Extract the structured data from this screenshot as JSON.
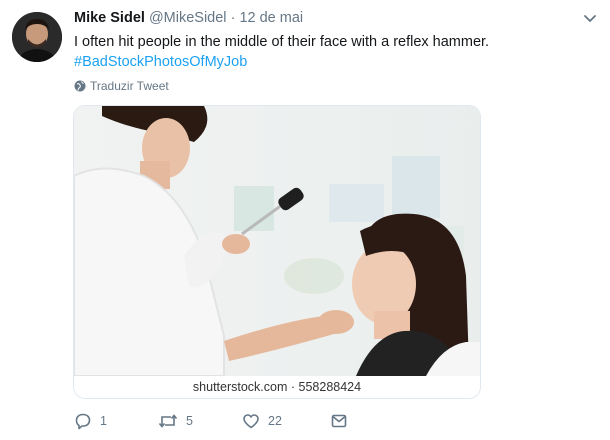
{
  "tweet": {
    "author_name": "Mike Sidel",
    "author_handle": "@MikeSidel",
    "separator": "·",
    "date": "12 de mai",
    "text": "I often hit people in the middle of their face with a reflex hammer.",
    "hashtag": "#BadStockPhotosOfMyJob",
    "translate_label": "Traduzir Tweet",
    "media_caption": "shutterstock.com · 558288424",
    "stats": {
      "replies": "1",
      "retweets": "5",
      "likes": "22"
    }
  },
  "colors": {
    "link": "#1da1f2",
    "muted": "#657786",
    "text": "#14171a"
  }
}
